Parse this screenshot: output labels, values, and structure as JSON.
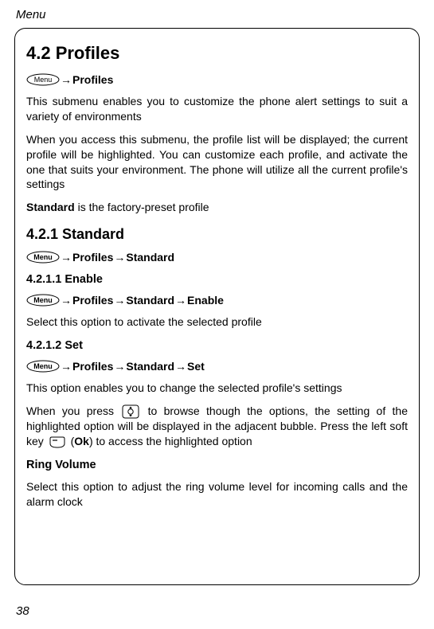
{
  "header": {
    "title": "Menu"
  },
  "section": {
    "heading": "4.2 Profiles",
    "breadcrumb1": {
      "p1": "Profiles"
    },
    "para1": "This submenu enables you to customize the phone alert settings to suit a variety of environments",
    "para2": "When you access this submenu, the profile list will be displayed; the current profile will be highlighted. You can customize each profile, and activate the one that suits your environment. The phone will utilize all the current profile's settings",
    "para3a": "Standard",
    "para3b": " is the factory-preset profile",
    "sub1": {
      "heading": "4.2.1 Standard",
      "breadcrumb": {
        "p1": "Profiles",
        "p2": "Standard"
      },
      "s1": {
        "heading": "4.2.1.1 Enable",
        "breadcrumb": {
          "p1": "Profiles",
          "p2": "Standard",
          "p3": "Enable"
        },
        "para": "Select this option to activate the selected profile"
      },
      "s2": {
        "heading": "4.2.1.2 Set",
        "breadcrumb": {
          "p1": "Profiles",
          "p2": "Standard",
          "p3": "Set"
        },
        "para1": "This option enables you to change the selected profile's settings",
        "para2a": "When you press ",
        "para2b": " to browse though the options, the setting of the highlighted option will be displayed in the adjacent bubble. Press the left soft key ",
        "para2c": " (",
        "para2d": "Ok",
        "para2e": ") to access the highlighted option",
        "ring_heading": "Ring Volume",
        "ring_para": "Select this option to adjust the ring volume level for incoming calls and the alarm clock"
      }
    }
  },
  "page_number": "38",
  "arrow": "→"
}
